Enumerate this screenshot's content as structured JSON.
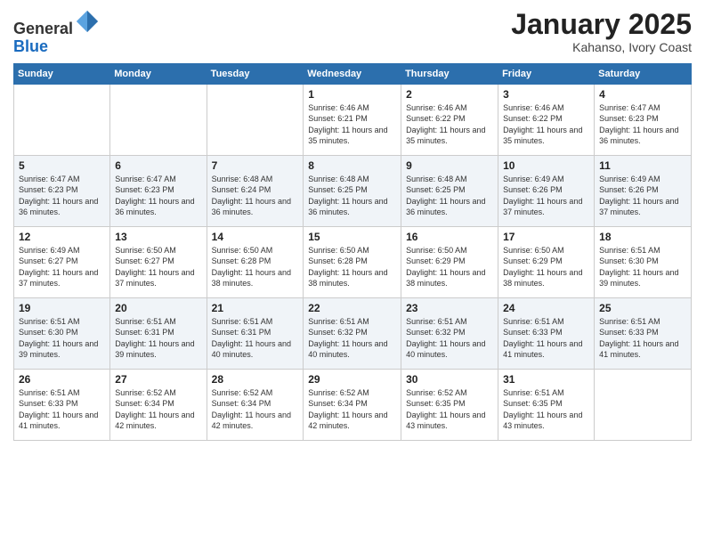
{
  "logo": {
    "general": "General",
    "blue": "Blue"
  },
  "header": {
    "month": "January 2025",
    "location": "Kahanso, Ivory Coast"
  },
  "weekdays": [
    "Sunday",
    "Monday",
    "Tuesday",
    "Wednesday",
    "Thursday",
    "Friday",
    "Saturday"
  ],
  "weeks": [
    [
      {
        "day": "",
        "sunrise": "",
        "sunset": "",
        "daylight": ""
      },
      {
        "day": "",
        "sunrise": "",
        "sunset": "",
        "daylight": ""
      },
      {
        "day": "",
        "sunrise": "",
        "sunset": "",
        "daylight": ""
      },
      {
        "day": "1",
        "sunrise": "Sunrise: 6:46 AM",
        "sunset": "Sunset: 6:21 PM",
        "daylight": "Daylight: 11 hours and 35 minutes."
      },
      {
        "day": "2",
        "sunrise": "Sunrise: 6:46 AM",
        "sunset": "Sunset: 6:22 PM",
        "daylight": "Daylight: 11 hours and 35 minutes."
      },
      {
        "day": "3",
        "sunrise": "Sunrise: 6:46 AM",
        "sunset": "Sunset: 6:22 PM",
        "daylight": "Daylight: 11 hours and 35 minutes."
      },
      {
        "day": "4",
        "sunrise": "Sunrise: 6:47 AM",
        "sunset": "Sunset: 6:23 PM",
        "daylight": "Daylight: 11 hours and 36 minutes."
      }
    ],
    [
      {
        "day": "5",
        "sunrise": "Sunrise: 6:47 AM",
        "sunset": "Sunset: 6:23 PM",
        "daylight": "Daylight: 11 hours and 36 minutes."
      },
      {
        "day": "6",
        "sunrise": "Sunrise: 6:47 AM",
        "sunset": "Sunset: 6:23 PM",
        "daylight": "Daylight: 11 hours and 36 minutes."
      },
      {
        "day": "7",
        "sunrise": "Sunrise: 6:48 AM",
        "sunset": "Sunset: 6:24 PM",
        "daylight": "Daylight: 11 hours and 36 minutes."
      },
      {
        "day": "8",
        "sunrise": "Sunrise: 6:48 AM",
        "sunset": "Sunset: 6:25 PM",
        "daylight": "Daylight: 11 hours and 36 minutes."
      },
      {
        "day": "9",
        "sunrise": "Sunrise: 6:48 AM",
        "sunset": "Sunset: 6:25 PM",
        "daylight": "Daylight: 11 hours and 36 minutes."
      },
      {
        "day": "10",
        "sunrise": "Sunrise: 6:49 AM",
        "sunset": "Sunset: 6:26 PM",
        "daylight": "Daylight: 11 hours and 37 minutes."
      },
      {
        "day": "11",
        "sunrise": "Sunrise: 6:49 AM",
        "sunset": "Sunset: 6:26 PM",
        "daylight": "Daylight: 11 hours and 37 minutes."
      }
    ],
    [
      {
        "day": "12",
        "sunrise": "Sunrise: 6:49 AM",
        "sunset": "Sunset: 6:27 PM",
        "daylight": "Daylight: 11 hours and 37 minutes."
      },
      {
        "day": "13",
        "sunrise": "Sunrise: 6:50 AM",
        "sunset": "Sunset: 6:27 PM",
        "daylight": "Daylight: 11 hours and 37 minutes."
      },
      {
        "day": "14",
        "sunrise": "Sunrise: 6:50 AM",
        "sunset": "Sunset: 6:28 PM",
        "daylight": "Daylight: 11 hours and 38 minutes."
      },
      {
        "day": "15",
        "sunrise": "Sunrise: 6:50 AM",
        "sunset": "Sunset: 6:28 PM",
        "daylight": "Daylight: 11 hours and 38 minutes."
      },
      {
        "day": "16",
        "sunrise": "Sunrise: 6:50 AM",
        "sunset": "Sunset: 6:29 PM",
        "daylight": "Daylight: 11 hours and 38 minutes."
      },
      {
        "day": "17",
        "sunrise": "Sunrise: 6:50 AM",
        "sunset": "Sunset: 6:29 PM",
        "daylight": "Daylight: 11 hours and 38 minutes."
      },
      {
        "day": "18",
        "sunrise": "Sunrise: 6:51 AM",
        "sunset": "Sunset: 6:30 PM",
        "daylight": "Daylight: 11 hours and 39 minutes."
      }
    ],
    [
      {
        "day": "19",
        "sunrise": "Sunrise: 6:51 AM",
        "sunset": "Sunset: 6:30 PM",
        "daylight": "Daylight: 11 hours and 39 minutes."
      },
      {
        "day": "20",
        "sunrise": "Sunrise: 6:51 AM",
        "sunset": "Sunset: 6:31 PM",
        "daylight": "Daylight: 11 hours and 39 minutes."
      },
      {
        "day": "21",
        "sunrise": "Sunrise: 6:51 AM",
        "sunset": "Sunset: 6:31 PM",
        "daylight": "Daylight: 11 hours and 40 minutes."
      },
      {
        "day": "22",
        "sunrise": "Sunrise: 6:51 AM",
        "sunset": "Sunset: 6:32 PM",
        "daylight": "Daylight: 11 hours and 40 minutes."
      },
      {
        "day": "23",
        "sunrise": "Sunrise: 6:51 AM",
        "sunset": "Sunset: 6:32 PM",
        "daylight": "Daylight: 11 hours and 40 minutes."
      },
      {
        "day": "24",
        "sunrise": "Sunrise: 6:51 AM",
        "sunset": "Sunset: 6:33 PM",
        "daylight": "Daylight: 11 hours and 41 minutes."
      },
      {
        "day": "25",
        "sunrise": "Sunrise: 6:51 AM",
        "sunset": "Sunset: 6:33 PM",
        "daylight": "Daylight: 11 hours and 41 minutes."
      }
    ],
    [
      {
        "day": "26",
        "sunrise": "Sunrise: 6:51 AM",
        "sunset": "Sunset: 6:33 PM",
        "daylight": "Daylight: 11 hours and 41 minutes."
      },
      {
        "day": "27",
        "sunrise": "Sunrise: 6:52 AM",
        "sunset": "Sunset: 6:34 PM",
        "daylight": "Daylight: 11 hours and 42 minutes."
      },
      {
        "day": "28",
        "sunrise": "Sunrise: 6:52 AM",
        "sunset": "Sunset: 6:34 PM",
        "daylight": "Daylight: 11 hours and 42 minutes."
      },
      {
        "day": "29",
        "sunrise": "Sunrise: 6:52 AM",
        "sunset": "Sunset: 6:34 PM",
        "daylight": "Daylight: 11 hours and 42 minutes."
      },
      {
        "day": "30",
        "sunrise": "Sunrise: 6:52 AM",
        "sunset": "Sunset: 6:35 PM",
        "daylight": "Daylight: 11 hours and 43 minutes."
      },
      {
        "day": "31",
        "sunrise": "Sunrise: 6:51 AM",
        "sunset": "Sunset: 6:35 PM",
        "daylight": "Daylight: 11 hours and 43 minutes."
      },
      {
        "day": "",
        "sunrise": "",
        "sunset": "",
        "daylight": ""
      }
    ]
  ]
}
